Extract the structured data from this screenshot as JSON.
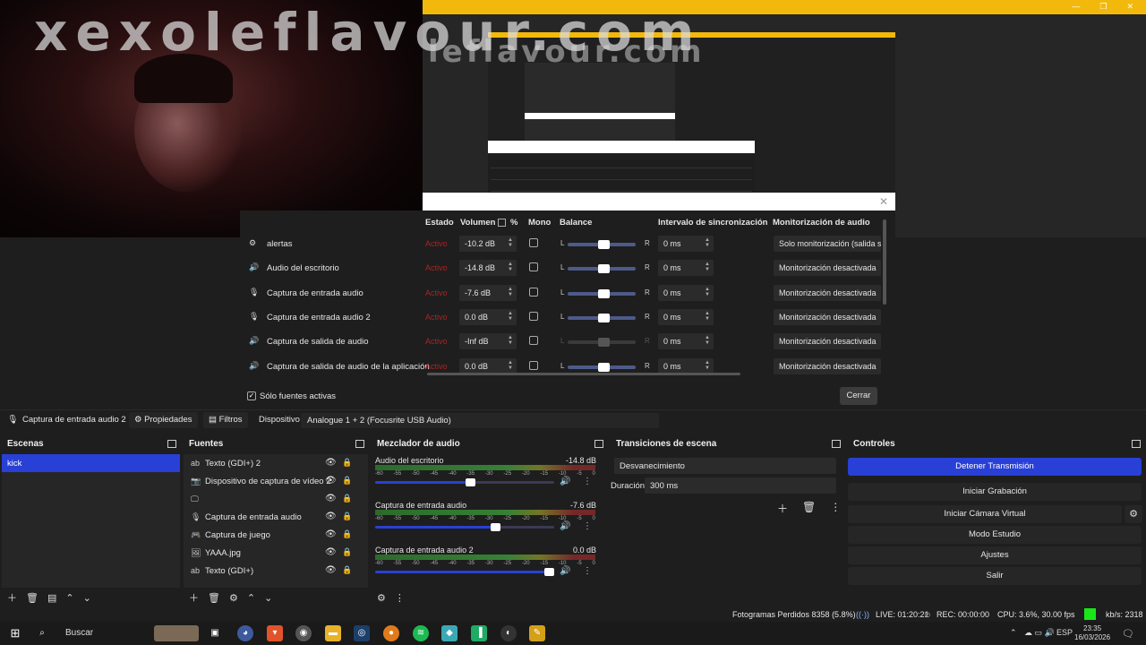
{
  "preview": {
    "watermark": "xexoleflavour.com",
    "watermark_echo": "leflavour.com",
    "window_controls": [
      "—",
      "❐",
      "✕"
    ]
  },
  "audio_dialog": {
    "headers": {
      "estado": "Estado",
      "volumen": "Volumen",
      "pct": "%",
      "mono": "Mono",
      "balance": "Balance",
      "sync": "Intervalo de sincronización",
      "monitor": "Monitorización de audio"
    },
    "rows": [
      {
        "icon": "gear-icon",
        "glyph": "⚙",
        "name": "alertas",
        "estado": "Activo",
        "volume": "-10.2 dB",
        "balance_l": "L",
        "balance_r": "R",
        "sync": "0 ms",
        "monitor": "Solo monitorización (salida s"
      },
      {
        "icon": "speaker-icon",
        "glyph": "🔊",
        "name": "Audio del escritorio",
        "estado": "Activo",
        "volume": "-14.8 dB",
        "balance_l": "L",
        "balance_r": "R",
        "sync": "0 ms",
        "monitor": "Monitorización desactivada"
      },
      {
        "icon": "microphone-icon",
        "glyph": "🎙",
        "name": "Captura de entrada audio",
        "estado": "Activo",
        "volume": "-7.6 dB",
        "balance_l": "L",
        "balance_r": "R",
        "sync": "0 ms",
        "monitor": "Monitorización desactivada"
      },
      {
        "icon": "microphone-icon",
        "glyph": "🎙",
        "name": "Captura de entrada audio 2",
        "estado": "Activo",
        "volume": "0.0 dB",
        "balance_l": "L",
        "balance_r": "R",
        "sync": "0 ms",
        "monitor": "Monitorización desactivada"
      },
      {
        "icon": "speaker-icon",
        "glyph": "🔊",
        "name": "Captura de salida de audio",
        "estado": "Activo",
        "volume": "-Inf dB",
        "balance_l": "L",
        "balance_r": "R",
        "sync": "0 ms",
        "monitor": "Monitorización desactivada"
      },
      {
        "icon": "speaker-icon",
        "glyph": "🔊",
        "name": "Captura de salida de audio de la aplicación",
        "estado": "Activo",
        "volume": "0.0 dB",
        "balance_l": "L",
        "balance_r": "R",
        "sync": "0 ms",
        "monitor": "Monitorización desactivada"
      }
    ],
    "only_active_label": "Sólo fuentes activas",
    "close_label": "Cerrar"
  },
  "source_toolbar": {
    "selected_source": "Captura de entrada audio 2",
    "properties_label": "Propiedades",
    "filters_label": "Filtros",
    "device_label": "Dispositivo",
    "device_value": "Analogue 1 + 2 (Focusrite USB Audio)"
  },
  "docks": {
    "scenes": {
      "title": "Escenas",
      "items": [
        "kick"
      ]
    },
    "sources": {
      "title": "Fuentes",
      "items": [
        {
          "icon": "text-icon",
          "glyph": "ab",
          "name": "Texto (GDI+) 2"
        },
        {
          "icon": "camera-icon",
          "glyph": "📷",
          "name": "Dispositivo de captura de vídeo 2"
        },
        {
          "icon": "monitor-icon",
          "glyph": "🖵",
          "name": ""
        },
        {
          "icon": "microphone-icon",
          "glyph": "🎙",
          "name": "Captura de entrada audio"
        },
        {
          "icon": "gamepad-icon",
          "glyph": "🎮",
          "name": "Captura de juego"
        },
        {
          "icon": "image-icon",
          "glyph": "🖼",
          "name": "YAAA.jpg"
        },
        {
          "icon": "text-icon",
          "glyph": "ab",
          "name": "Texto (GDI+)"
        }
      ]
    },
    "mixer": {
      "title": "Mezclador de audio",
      "ticks": [
        "-60",
        "-55",
        "-50",
        "-45",
        "-40",
        "-35",
        "-30",
        "-25",
        "-20",
        "-15",
        "-10",
        "-5",
        "0"
      ],
      "channels": [
        {
          "name": "Audio del escritorio",
          "db": "-14.8 dB",
          "level": 0.56
        },
        {
          "name": "Captura de entrada audio",
          "db": "-7.6 dB",
          "level": 0.7
        },
        {
          "name": "Captura de entrada audio 2",
          "db": "0.0 dB",
          "level": 1.0
        }
      ]
    },
    "transitions": {
      "title": "Transiciones de escena",
      "selected": "Desvanecimiento",
      "duration_label": "Duración",
      "duration_value": "300 ms"
    },
    "controls": {
      "title": "Controles",
      "buttons": [
        "Detener Transmisión",
        "Iniciar Grabación",
        "Iniciar Cámara Virtual",
        "Modo Estudio",
        "Ajustes",
        "Salir"
      ]
    }
  },
  "status": {
    "dropped": "Fotogramas Perdidos 8358 (5.8%)",
    "live": "LIVE: 01:20:21",
    "rec": "REC: 00:00:00",
    "cpu": "CPU: 3.6%, 30.00 fps",
    "bitrate": "kb/s: 2318"
  },
  "taskbar": {
    "search_label": "Buscar",
    "lang": "ESP",
    "time": "23:35",
    "date": "16/03/2026"
  },
  "colors": {
    "accent": "#2840d6",
    "gold": "#f2b90c",
    "status_red": "#b32020",
    "stream_ok": "#19e619"
  }
}
